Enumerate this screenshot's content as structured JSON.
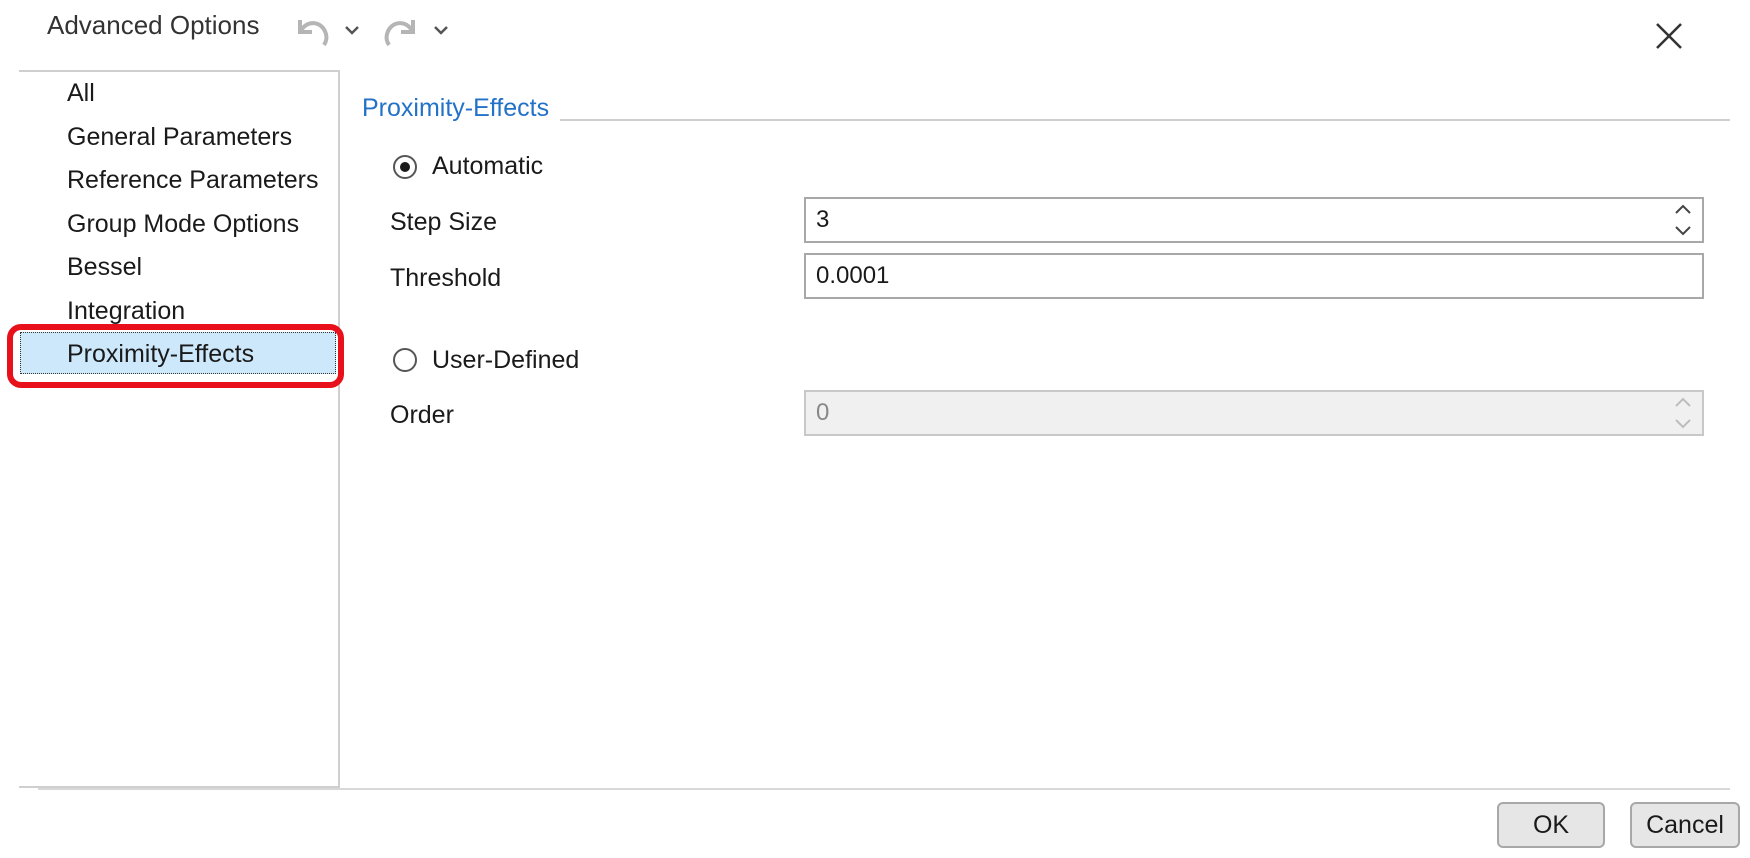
{
  "window": {
    "title": "Advanced Options"
  },
  "nav": {
    "items": [
      {
        "label": "All"
      },
      {
        "label": "General Parameters"
      },
      {
        "label": "Reference Parameters"
      },
      {
        "label": "Group Mode Options"
      },
      {
        "label": "Bessel"
      },
      {
        "label": "Integration"
      },
      {
        "label": "Proximity-Effects"
      }
    ],
    "selected": "Proximity-Effects"
  },
  "panel": {
    "group_title": "Proximity-Effects",
    "automatic": {
      "label": "Automatic",
      "checked": true
    },
    "step_size": {
      "label": "Step Size",
      "value": "3"
    },
    "threshold": {
      "label": "Threshold",
      "value": "0.0001"
    },
    "user_defined": {
      "label": "User-Defined",
      "checked": false
    },
    "order": {
      "label": "Order",
      "value": "0"
    }
  },
  "buttons": {
    "ok": "OK",
    "cancel": "Cancel"
  },
  "icons": {
    "undo": "undo-icon",
    "redo": "redo-icon",
    "close": "close-icon"
  },
  "colors": {
    "accent": "#2372c8",
    "selection": "#cde8fb",
    "highlight": "#e8101a"
  }
}
